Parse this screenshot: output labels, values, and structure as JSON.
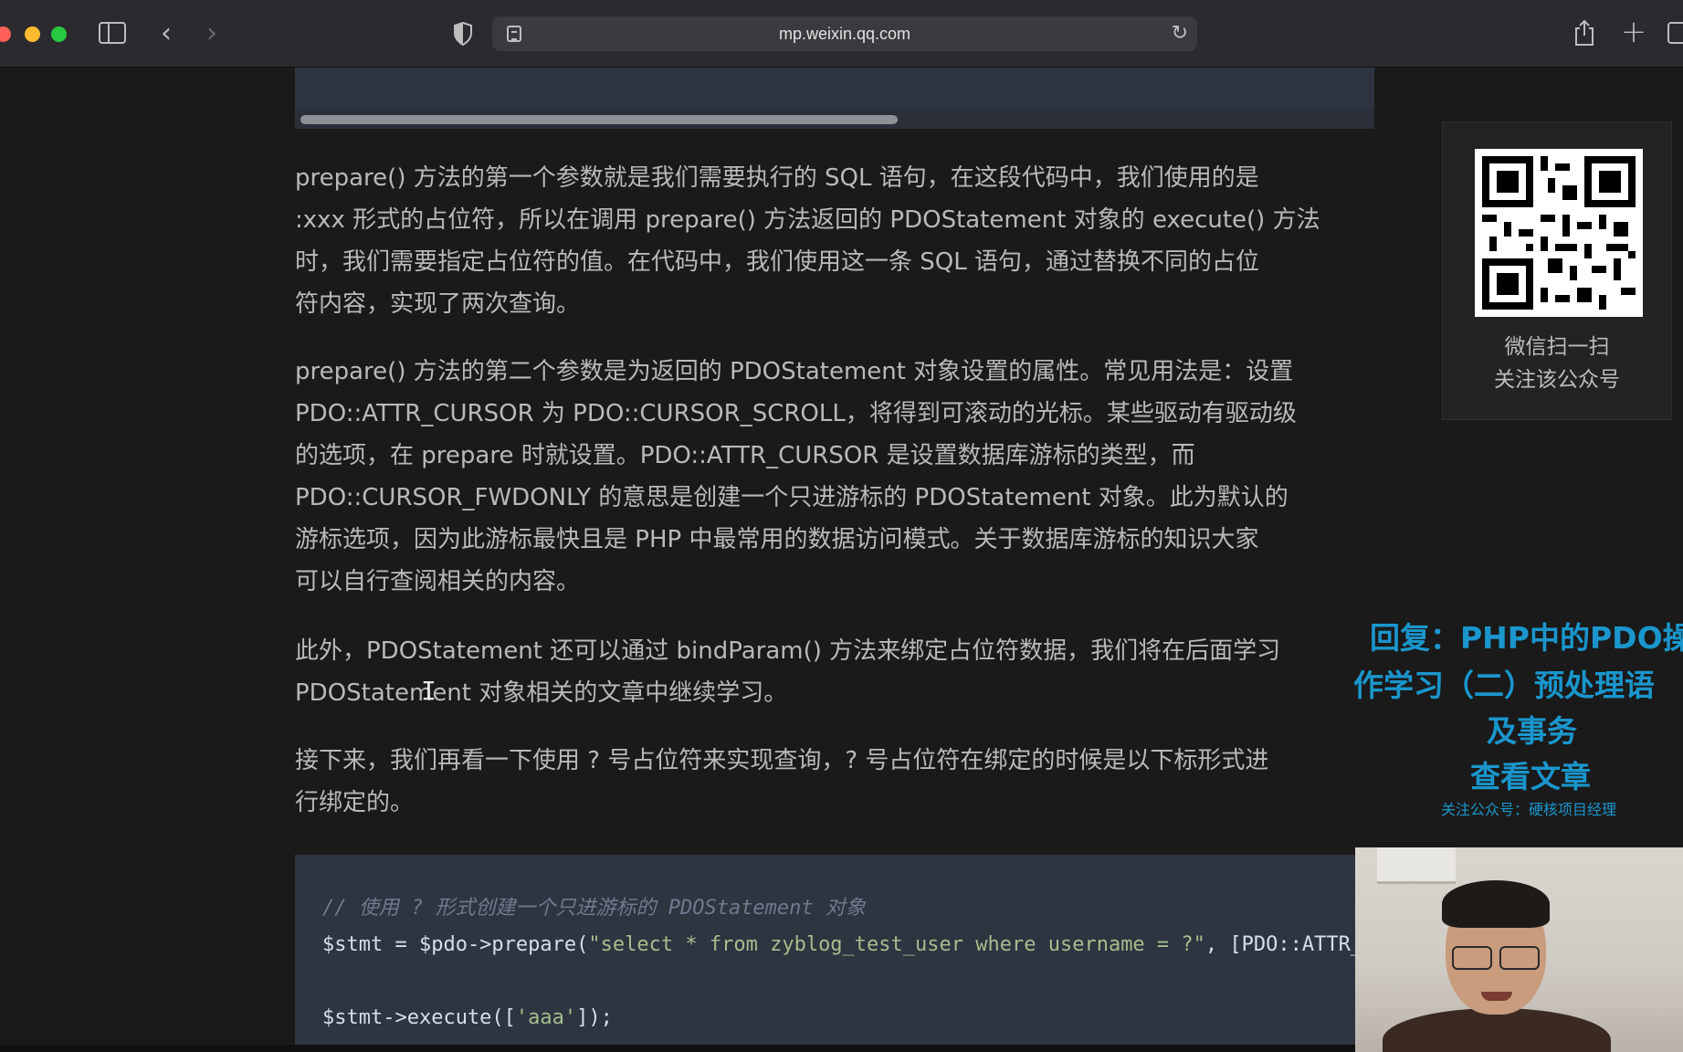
{
  "browser": {
    "url": "mp.weixin.qq.com"
  },
  "article": {
    "paragraphs": [
      "prepare() 方法的第一个参数就是我们需要执行的 SQL 语句，在这段代码中，我们使用的是\n:xxx 形式的占位符，所以在调用 prepare() 方法返回的 PDOStatement 对象的 execute() 方法\n时，我们需要指定占位符的值。在代码中，我们使用这一条 SQL 语句，通过替换不同的占位\n符内容，实现了两次查询。",
      "prepare() 方法的第二个参数是为返回的 PDOStatement 对象设置的属性。常见用法是：设置\nPDO::ATTR_CURSOR 为 PDO::CURSOR_SCROLL，将得到可滚动的光标。某些驱动有驱动级\n的选项，在 prepare 时就设置。PDO::ATTR_CURSOR 是设置数据库游标的类型，而\nPDO::CURSOR_FWDONLY 的意思是创建一个只进游标的 PDOStatement 对象。此为默认的\n游标选项，因为此游标最快且是 PHP 中最常用的数据访问模式。关于数据库游标的知识大家\n可以自行查阅相关的内容。",
      "此外，PDOStatement 还可以通过 bindParam() 方法来绑定占位符数据，我们将在后面学习\nPDOStatement 对象相关的文章中继续学习。",
      "接下来，我们再看一下使用 ? 号占位符来实现查询，? 号占位符在绑定的时候是以下标形式进\n行绑定的。"
    ],
    "code": {
      "comment": "// 使用 ? 形式创建一个只进游标的 PDOStatement 对象",
      "line2_prefix": "$stmt = $pdo->prepare(",
      "line2_string": "\"select * from zyblog_test_user where username = ?\"",
      "line2_suffix": ", [PDO::ATTR_CU",
      "line3_prefix": "$stmt->execute([",
      "line3_string": "'aaa'",
      "line3_suffix": "]);"
    }
  },
  "qr_panel": {
    "caption": "微信扫一扫\n关注该公众号"
  },
  "overlay": {
    "reply_line1": "回复：PHP中的PDO操",
    "reply_line2": "作学习（二）预处理语",
    "reply_line3": "及事务",
    "reply_line4": "查看文章",
    "reply_sub": "关注公众号：硬核项目经理",
    "color": "#1a96cc"
  },
  "icons": [
    "sidebar-icon",
    "back-icon",
    "forward-icon",
    "shield-icon",
    "reader-icon",
    "reload-icon",
    "share-icon",
    "plus-icon",
    "tabs-icon"
  ]
}
